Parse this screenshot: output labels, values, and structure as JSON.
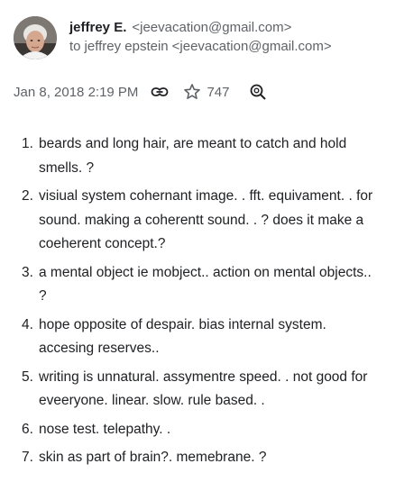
{
  "sender": {
    "name": "jeffrey E.",
    "email": "<jeevacation@gmail.com>"
  },
  "recipient": {
    "prefix": "to",
    "name": "jeffrey epstein",
    "email": "<jeevacation@gmail.com>"
  },
  "meta": {
    "date": "Jan 8, 2018 2:19 PM",
    "star_count": "747",
    "icons": [
      "link-icon",
      "star-icon",
      "zoom-icon"
    ]
  },
  "colors": {
    "primary_text": "#202124",
    "secondary_text": "#5f6368"
  },
  "items": [
    {
      "num": "1.",
      "text": "beards and long hair, are meant to catch and hold smells. ?"
    },
    {
      "num": "2.",
      "text": "visiual system cohernant image. . fft. equivament. . for sound. making a coherentt sound. . ? does it make a coeherent concept.?"
    },
    {
      "num": "3.",
      "text": "a mental object ie mobject.. action on mental objects.. ?"
    },
    {
      "num": "4.",
      "text": "hope opposite of despair. bias internal system. accesing reserves.."
    },
    {
      "num": "5.",
      "text": "writing is unnatural. assymentre speed. . not good for eveeryone. linear. slow. rule based. ."
    },
    {
      "num": "6.",
      "text": "nose test. telepathy. ."
    },
    {
      "num": "7.",
      "text": "skin as part of brain?. memebrane. ?"
    }
  ]
}
